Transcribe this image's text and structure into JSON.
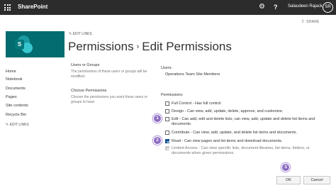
{
  "suitebar": {
    "app_name": "SharePoint",
    "help_glyph": "?",
    "user_name": "Salaudeen Rajack",
    "avatar_initials": "SR",
    "settings_icon": "gear-icon",
    "waffle_icon": "app-launcher-icon"
  },
  "header": {
    "share_label": "SHARE",
    "edit_links_label": "EDIT LINKS",
    "title_part1": "Permissions",
    "title_separator": "›",
    "title_part2": "Edit Permissions",
    "logo_letter": "S"
  },
  "nav": {
    "items": [
      {
        "label": "Home"
      },
      {
        "label": "Notebook"
      },
      {
        "label": "Documents"
      },
      {
        "label": "Pages"
      },
      {
        "label": "Site contents"
      },
      {
        "label": "Recycle Bin"
      }
    ],
    "edit_links_label": "EDIT LINKS"
  },
  "users_section": {
    "heading": "Users or Groups",
    "description": "The permissions of these users or groups will be modified.",
    "label": "Users:",
    "value": "Operations Team Site Members"
  },
  "permissions_section": {
    "heading": "Choose Permissions",
    "description": "Choose the permissions you want these users or groups to have.",
    "label": "Permissions:",
    "options": [
      {
        "text": "Full Control - Has full control.",
        "checked": false,
        "disabled": false
      },
      {
        "text": "Design - Can view, add, update, delete, approve, and customize.",
        "checked": false,
        "disabled": false
      },
      {
        "text": "Edit - Can add, edit and delete lists; can view, add, update and delete list items and documents.",
        "checked": false,
        "disabled": false
      },
      {
        "text": "Contribute - Can view, add, update, and delete list items and documents.",
        "checked": false,
        "disabled": false
      },
      {
        "text": "Read - Can view pages and list items and download documents.",
        "checked": true,
        "disabled": false
      },
      {
        "text": "Limited Access - Can view specific lists, document libraries, list items, folders, or documents when given permissions.",
        "checked": true,
        "disabled": true
      }
    ]
  },
  "markers": [
    "1",
    "2",
    "3"
  ],
  "buttons": {
    "ok_label": "OK",
    "cancel_label": "Cancel"
  },
  "colors": {
    "suitebar": "#2c2c2c",
    "logo": "#036c70",
    "checkbox_checked": "#0f4f8f",
    "marker": "#8c6cc0"
  }
}
